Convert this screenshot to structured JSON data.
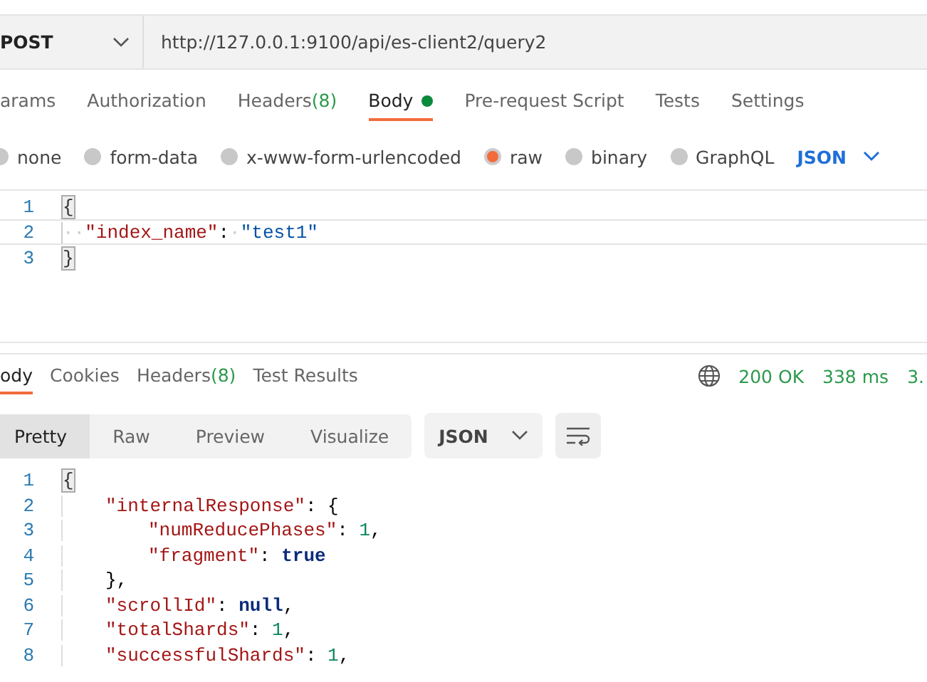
{
  "request": {
    "method": "POST",
    "url": "http://127.0.0.1:9100/api/es-client2/query2"
  },
  "request_tabs": [
    {
      "label": "arams",
      "selected": false
    },
    {
      "label": "Authorization",
      "selected": false
    },
    {
      "label": "Headers",
      "count": "(8)",
      "selected": false
    },
    {
      "label": "Body",
      "dot": true,
      "selected": true
    },
    {
      "label": "Pre-request Script",
      "selected": false
    },
    {
      "label": "Tests",
      "selected": false
    },
    {
      "label": "Settings",
      "selected": false
    }
  ],
  "body_types": [
    {
      "label": "none",
      "selected": false
    },
    {
      "label": "form-data",
      "selected": false
    },
    {
      "label": "x-www-form-urlencoded",
      "selected": false
    },
    {
      "label": "raw",
      "selected": true
    },
    {
      "label": "binary",
      "selected": false
    },
    {
      "label": "GraphQL",
      "selected": false
    }
  ],
  "body_format": "JSON",
  "request_body": [
    {
      "number": "1",
      "tokens": [
        {
          "kind": "bracket",
          "text": "{"
        }
      ]
    },
    {
      "number": "2",
      "tokens": [
        {
          "kind": "space",
          "text": "··"
        },
        {
          "kind": "key",
          "text": "\"index_name\""
        },
        {
          "kind": "punct",
          "text": ":"
        },
        {
          "kind": "space",
          "text": "·"
        },
        {
          "kind": "string",
          "text": "\"test1\""
        }
      ]
    },
    {
      "number": "3",
      "tokens": [
        {
          "kind": "bracket",
          "text": "}"
        }
      ]
    }
  ],
  "response_tabs": [
    {
      "label": "ody",
      "selected": true
    },
    {
      "label": "Cookies",
      "selected": false
    },
    {
      "label": "Headers",
      "count": "(8)",
      "selected": false
    },
    {
      "label": "Test Results",
      "selected": false
    }
  ],
  "response_status": {
    "status": "200 OK",
    "time": "338 ms",
    "size": "3."
  },
  "view_modes": [
    {
      "label": "Pretty",
      "selected": true
    },
    {
      "label": "Raw",
      "selected": false
    },
    {
      "label": "Preview",
      "selected": false
    },
    {
      "label": "Visualize",
      "selected": false
    }
  ],
  "response_format": "JSON",
  "response_body": [
    {
      "number": "1",
      "tokens": [
        {
          "kind": "bracket",
          "text": "{"
        }
      ]
    },
    {
      "number": "2",
      "kind": "inner",
      "tokens": [
        {
          "kind": "key",
          "text": "\"internalResponse\""
        },
        {
          "kind": "punct",
          "text": ": {"
        }
      ]
    },
    {
      "number": "3",
      "kind": "inner2",
      "tokens": [
        {
          "kind": "key",
          "text": "\"numReducePhases\""
        },
        {
          "kind": "punct",
          "text": ": "
        },
        {
          "kind": "number",
          "text": "1"
        },
        {
          "kind": "punct",
          "text": ","
        }
      ]
    },
    {
      "number": "4",
      "kind": "inner2",
      "tokens": [
        {
          "kind": "key",
          "text": "\"fragment\""
        },
        {
          "kind": "punct",
          "text": ": "
        },
        {
          "kind": "keyword",
          "text": "true"
        }
      ]
    },
    {
      "number": "5",
      "kind": "inner",
      "tokens": [
        {
          "kind": "punct",
          "text": "},"
        }
      ]
    },
    {
      "number": "6",
      "kind": "inner",
      "tokens": [
        {
          "kind": "key",
          "text": "\"scrollId\""
        },
        {
          "kind": "punct",
          "text": ": "
        },
        {
          "kind": "keyword",
          "text": "null"
        },
        {
          "kind": "punct",
          "text": ","
        }
      ]
    },
    {
      "number": "7",
      "kind": "inner",
      "tokens": [
        {
          "kind": "key",
          "text": "\"totalShards\""
        },
        {
          "kind": "punct",
          "text": ": "
        },
        {
          "kind": "number",
          "text": "1"
        },
        {
          "kind": "punct",
          "text": ","
        }
      ]
    },
    {
      "number": "8",
      "kind": "inner",
      "tokens": [
        {
          "kind": "key",
          "text": "\"successfulShards\""
        },
        {
          "kind": "punct",
          "text": ": "
        },
        {
          "kind": "number",
          "text": "1"
        },
        {
          "kind": "punct",
          "text": ","
        }
      ]
    }
  ]
}
